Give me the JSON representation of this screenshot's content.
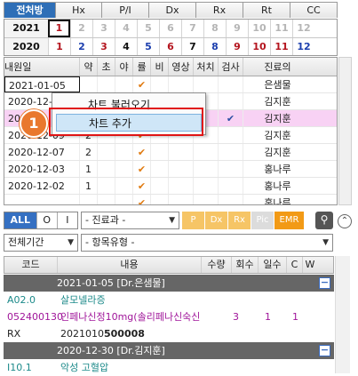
{
  "tabs": [
    "전처방",
    "Hx",
    "P/I",
    "Dx",
    "Rx",
    "Rt",
    "CC"
  ],
  "months": {
    "header": [
      "1",
      "2",
      "3",
      "4",
      "5",
      "6",
      "7",
      "8",
      "9",
      "10",
      "11",
      "12"
    ],
    "years": [
      {
        "year": "2021",
        "cells": [
          "1",
          "2",
          "3",
          "4",
          "5",
          "6",
          "7",
          "8",
          "9",
          "10",
          "11",
          "12"
        ],
        "colors": [
          "#b4141e",
          "#b5b5b5",
          "#b5b5b5",
          "#b5b5b5",
          "#b5b5b5",
          "#b5b5b5",
          "#b5b5b5",
          "#b5b5b5",
          "#b5b5b5",
          "#b5b5b5",
          "#b5b5b5",
          "#b5b5b5"
        ]
      },
      {
        "year": "2020",
        "cells": [
          "1",
          "2",
          "3",
          "4",
          "5",
          "6",
          "7",
          "8",
          "9",
          "10",
          "11",
          "12"
        ],
        "colors": [
          "#b4141e",
          "#1c3fae",
          "#b4141e",
          "#111111",
          "#1c3fae",
          "#b4141e",
          "#111111",
          "#1c3fae",
          "#b4141e",
          "#b4141e",
          "#b4141e",
          "#1c3fae"
        ]
      }
    ]
  },
  "visit_table": {
    "headers": [
      "내원일",
      "약",
      "초",
      "야",
      "률",
      "비",
      "영상",
      "처치",
      "검사",
      "진료의"
    ],
    "rows": [
      {
        "date": "2021-01-05",
        "yak": "",
        "cho": "",
        "ya": "",
        "ryul": "✔",
        "bi": "",
        "img": "",
        "treat": "",
        "exam": "",
        "doctor": "은샘물"
      },
      {
        "date": "2020-12-",
        "yak": "",
        "cho": "",
        "ya": "",
        "ryul": "",
        "bi": "",
        "img": "",
        "treat": "",
        "exam": "",
        "doctor": "김지훈"
      },
      {
        "date": "2020-",
        "yak": "",
        "cho": "",
        "ya": "",
        "ryul": "",
        "bi": "",
        "img": "",
        "treat": "",
        "exam": "✔",
        "doctor": "김지훈"
      },
      {
        "date": "2020-12-09",
        "yak": "2",
        "cho": "",
        "ya": "",
        "ryul": "✔",
        "bi": "",
        "img": "",
        "treat": "",
        "exam": "",
        "doctor": "김지훈"
      },
      {
        "date": "2020-12-07",
        "yak": "2",
        "cho": "",
        "ya": "",
        "ryul": "✔",
        "bi": "",
        "img": "",
        "treat": "",
        "exam": "",
        "doctor": "김지훈"
      },
      {
        "date": "2020-12-03",
        "yak": "1",
        "cho": "",
        "ya": "",
        "ryul": "✔",
        "bi": "",
        "img": "",
        "treat": "",
        "exam": "",
        "doctor": "홍나루"
      },
      {
        "date": "2020-12-02",
        "yak": "1",
        "cho": "",
        "ya": "",
        "ryul": "✔",
        "bi": "",
        "img": "",
        "treat": "",
        "exam": "",
        "doctor": "홍나루"
      },
      {
        "date": "",
        "yak": "",
        "cho": "",
        "ya": "",
        "ryul": "✔",
        "bi": "",
        "img": "",
        "treat": "",
        "exam": "",
        "doctor": "홍나루"
      }
    ]
  },
  "context_menu": {
    "items": [
      "차트 불러오기",
      "차트 추가"
    ],
    "step_badge": "1"
  },
  "filters": {
    "seg": [
      "ALL",
      "O",
      "I"
    ],
    "dept": "- 진료과 -",
    "period": "전체기간",
    "item_type": "- 항목유형 -",
    "chips": [
      "P",
      "Dx",
      "Rx",
      "Pic",
      "EMR"
    ]
  },
  "detail_table": {
    "headers": [
      "코드",
      "내용",
      "수량",
      "회수",
      "일수",
      "C",
      "W"
    ],
    "groups": [
      {
        "header": "2021-01-05 [Dr.은샘물]"
      },
      {
        "header": "2020-12-30 [Dr.김지훈]"
      }
    ],
    "rows": [
      {
        "code": "A02.0",
        "content": "살모넬라증",
        "qty": "",
        "times": "",
        "days": ""
      },
      {
        "code": "052400130",
        "content": "인페나신정10mg(솔리페나신숙신",
        "qty": "3",
        "times": "1",
        "days": "1"
      },
      {
        "code": "RX",
        "content_plain": "2021010",
        "content_bold": "50000",
        "content_rest": "8"
      },
      {
        "code": "I10.1",
        "content": "악성 고혈압"
      }
    ]
  }
}
